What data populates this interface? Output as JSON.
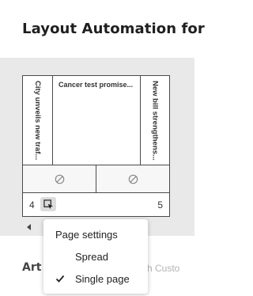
{
  "header": {
    "title": "Layout Automation for"
  },
  "spread": {
    "pages": [
      {
        "headline": "City unveils new traf..."
      },
      {
        "headline": "Cancer test promise..."
      },
      {
        "headline": "New bill strengthens..."
      }
    ],
    "left_page_number": "4",
    "right_page_number": "5"
  },
  "bottom_section": {
    "label": "Art",
    "hint": "ith Custo"
  },
  "menu": {
    "title": "Page settings",
    "items": [
      {
        "label": "Spread",
        "checked": false
      },
      {
        "label": "Single page",
        "checked": true
      }
    ]
  }
}
